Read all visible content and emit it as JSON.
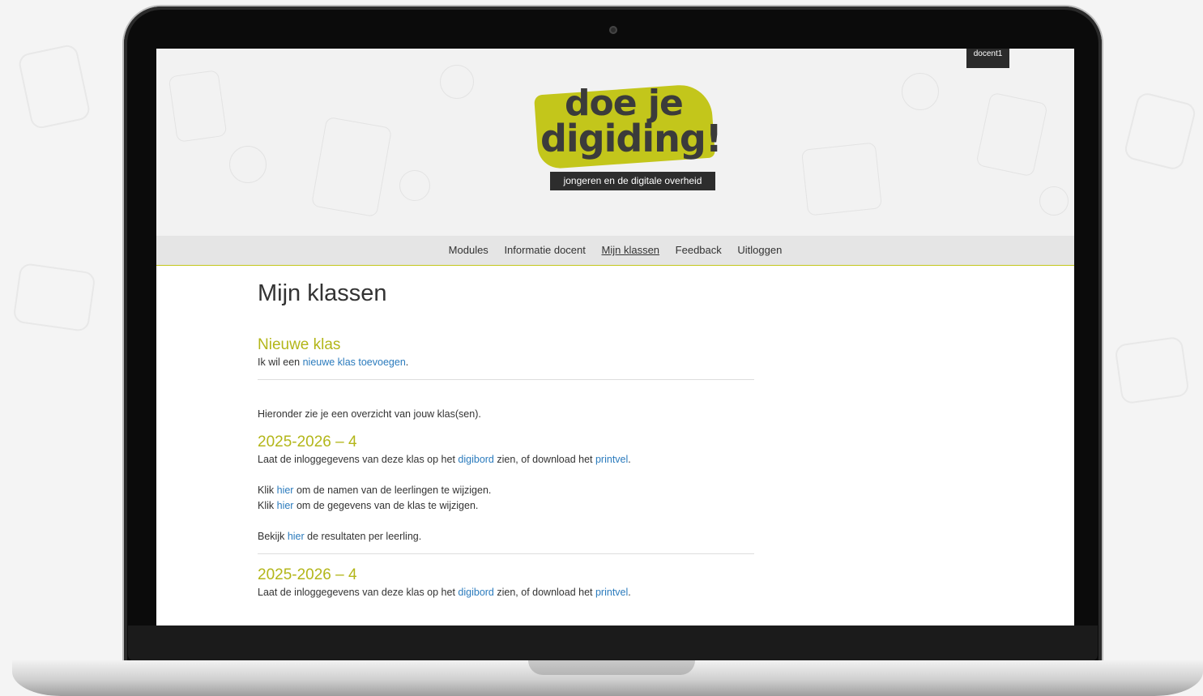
{
  "user": {
    "name": "docent1"
  },
  "logo": {
    "line1": "doe je",
    "line2": "digiding!",
    "tagline": "jongeren en de digitale overheid"
  },
  "nav": {
    "items": [
      {
        "label": "Modules",
        "active": false
      },
      {
        "label": "Informatie docent",
        "active": false
      },
      {
        "label": "Mijn klassen",
        "active": true
      },
      {
        "label": "Feedback",
        "active": false
      },
      {
        "label": "Uitloggen",
        "active": false
      }
    ]
  },
  "page": {
    "title": "Mijn klassen",
    "new_class": {
      "heading": "Nieuwe klas",
      "text_before": "Ik wil een ",
      "link": "nieuwe klas toevoegen",
      "text_after": "."
    },
    "intro": "Hieronder zie je een overzicht van jouw klas(sen).",
    "classes": [
      {
        "heading": "2025-2026 – 4",
        "login_before": "Laat de inloggegevens van deze klas op het ",
        "login_link1": "digibord",
        "login_middle": " zien, of download het ",
        "login_link2": "printvel",
        "login_after": ".",
        "names_before": "Klik ",
        "names_link": "hier",
        "names_after": " om de namen van de leerlingen te wijzigen.",
        "data_before": "Klik ",
        "data_link": "hier",
        "data_after": " om de gegevens van de klas te wijzigen.",
        "results_before": "Bekijk ",
        "results_link": "hier",
        "results_after": " de resultaten per leerling."
      },
      {
        "heading": "2025-2026 – 4",
        "login_before": "Laat de inloggegevens van deze klas op het ",
        "login_link1": "digibord",
        "login_middle": " zien, of download het ",
        "login_link2": "printvel",
        "login_after": "."
      }
    ]
  },
  "colors": {
    "accent": "#c3c61b",
    "heading_green": "#b3b619",
    "link": "#2b7bbd",
    "nav_bg": "#e5e5e5"
  }
}
